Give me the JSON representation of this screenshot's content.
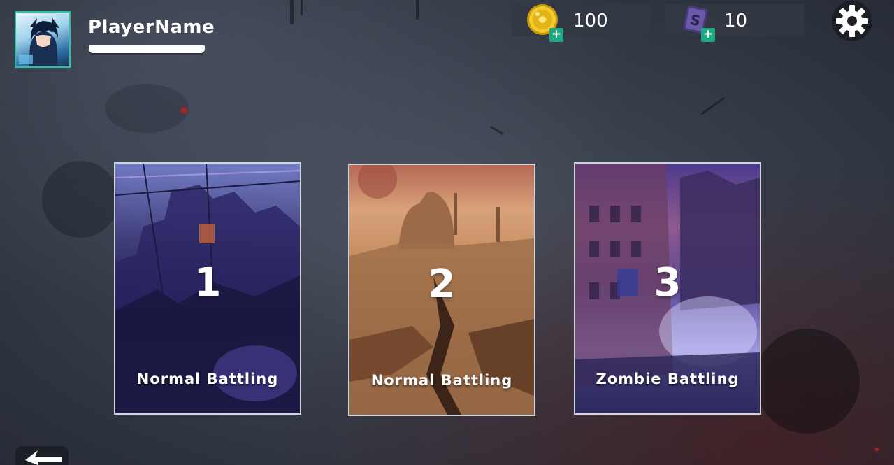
{
  "player": {
    "name": "PlayerName"
  },
  "currencies": [
    {
      "type": "gold-coin",
      "amount": "100",
      "add_label": "+"
    },
    {
      "type": "gem-card",
      "amount": "10",
      "add_label": "+"
    }
  ],
  "modes": [
    {
      "number": "1",
      "label": "Normal Battling"
    },
    {
      "number": "2",
      "label": "Normal Battling"
    },
    {
      "number": "3",
      "label": "Zombie Battling"
    }
  ],
  "icons": {
    "settings": "gear-icon",
    "back": "back-arrow-icon",
    "gold": "gold-coin-icon",
    "gem": "gem-card-icon"
  },
  "colors": {
    "accent": "#29c4a2",
    "plus_button": "#1fa882",
    "panel": "#323842",
    "background": "#343b47"
  }
}
